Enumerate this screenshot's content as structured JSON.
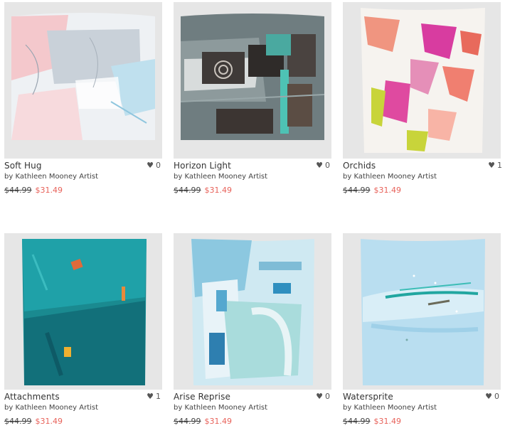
{
  "products": [
    {
      "title": "Soft Hug",
      "artist": "by Kathleen Mooney Artist",
      "old_price": "$44.99",
      "new_price": "$31.49",
      "likes": "0",
      "icon": "heart-icon"
    },
    {
      "title": "Horizon Light",
      "artist": "by Kathleen Mooney Artist",
      "old_price": "$44.99",
      "new_price": "$31.49",
      "likes": "0",
      "icon": "heart-icon"
    },
    {
      "title": "Orchids",
      "artist": "by Kathleen Mooney Artist",
      "old_price": "$44.99",
      "new_price": "$31.49",
      "likes": "1",
      "icon": "heart-icon"
    },
    {
      "title": "Attachments",
      "artist": "by Kathleen Mooney Artist",
      "old_price": "$44.99",
      "new_price": "$31.49",
      "likes": "1",
      "icon": "heart-icon"
    },
    {
      "title": "Arise Reprise",
      "artist": "by Kathleen Mooney Artist",
      "old_price": "$44.99",
      "new_price": "$31.49",
      "likes": "0",
      "icon": "heart-icon"
    },
    {
      "title": "Watersprite",
      "artist": "by Kathleen Mooney Artist",
      "old_price": "$44.99",
      "new_price": "$31.49",
      "likes": "0",
      "icon": "heart-icon"
    }
  ],
  "colors": {
    "sale_price": "#e8625a",
    "background": "#ffffff",
    "thumb_bg": "#e4e4e4"
  }
}
